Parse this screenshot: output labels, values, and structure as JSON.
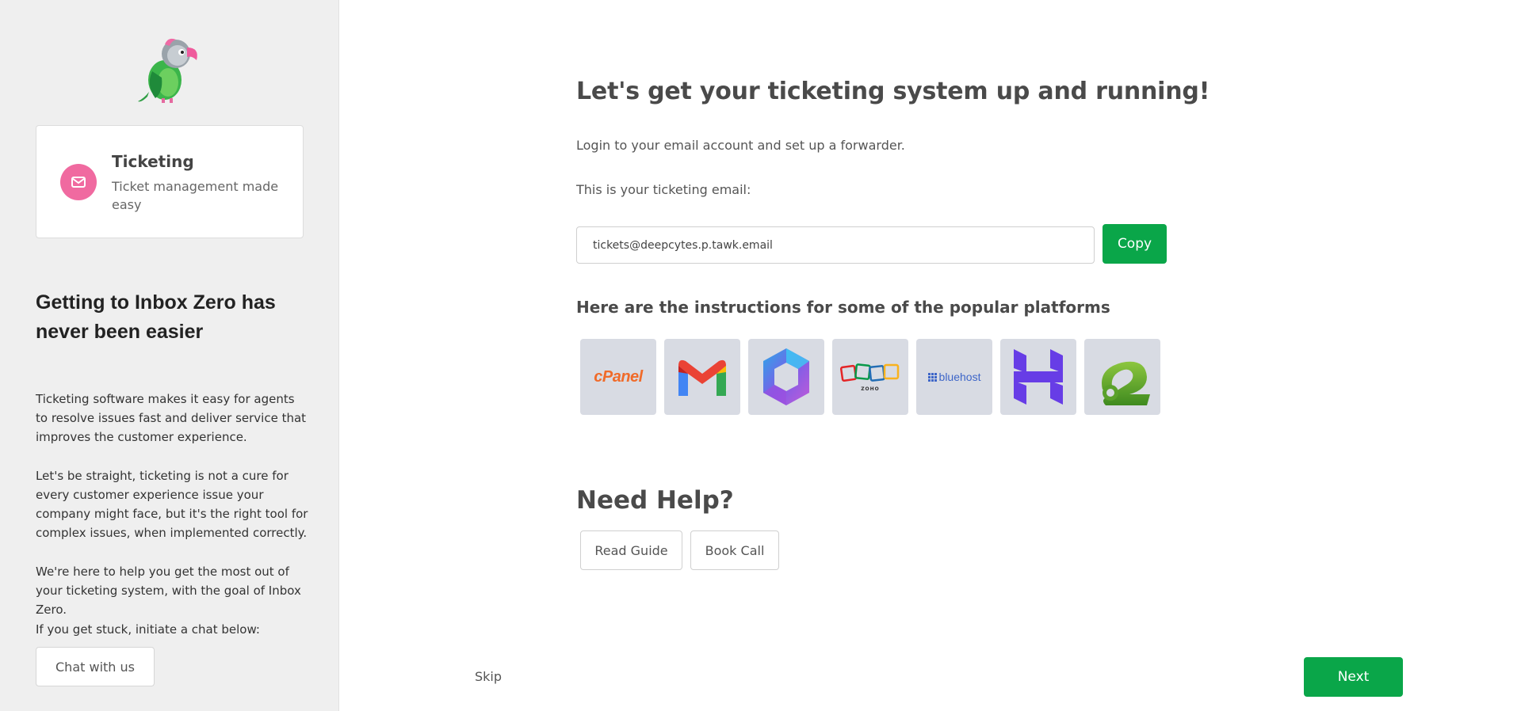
{
  "sidebar": {
    "product": {
      "title": "Ticketing",
      "description": "Ticket management made easy",
      "icon": "envelope-icon",
      "icon_color": "#f06aa0"
    },
    "heading": "Getting to Inbox Zero has never been easier",
    "paragraphs": [
      "Ticketing software makes it easy for agents to resolve issues fast and deliver service that improves the customer experience.",
      "Let's be straight, ticketing is not a cure for every customer experience issue your company might face, but it's the right tool for complex issues, when implemented correctly.",
      "We're here to help you get the most out of your ticketing system, with the goal of Inbox Zero.",
      "If you get stuck, initiate a chat below:"
    ],
    "chat_button": "Chat with us"
  },
  "main": {
    "title": "Let's get your ticketing system up and running!",
    "instruction": "Login to your email account and set up a forwarder.",
    "email_label": "This is your ticketing email:",
    "email_value": "tickets@deepcytes.p.tawk.email",
    "copy_button": "Copy",
    "platforms_title": "Here are the instructions for some of the popular platforms",
    "platforms": [
      {
        "name": "cPanel",
        "icon": "cpanel-logo"
      },
      {
        "name": "Gmail",
        "icon": "gmail-logo"
      },
      {
        "name": "Microsoft Office",
        "icon": "office-logo"
      },
      {
        "name": "Zoho",
        "icon": "zoho-logo"
      },
      {
        "name": "bluehost",
        "icon": "bluehost-logo"
      },
      {
        "name": "Hostinger",
        "icon": "hostinger-logo"
      },
      {
        "name": "A2 Hosting",
        "icon": "a2-logo"
      }
    ],
    "tile_labels": {
      "cpanel": "cPanel",
      "zoho": "ZOHO",
      "bluehost": "bluehost"
    },
    "help_title": "Need Help?",
    "read_guide": "Read Guide",
    "book_call": "Book Call",
    "skip": "Skip",
    "next": "Next"
  },
  "colors": {
    "accent_green": "#0aa649",
    "sidebar_bg": "#efefef",
    "tile_bg": "#d8dbe3"
  }
}
